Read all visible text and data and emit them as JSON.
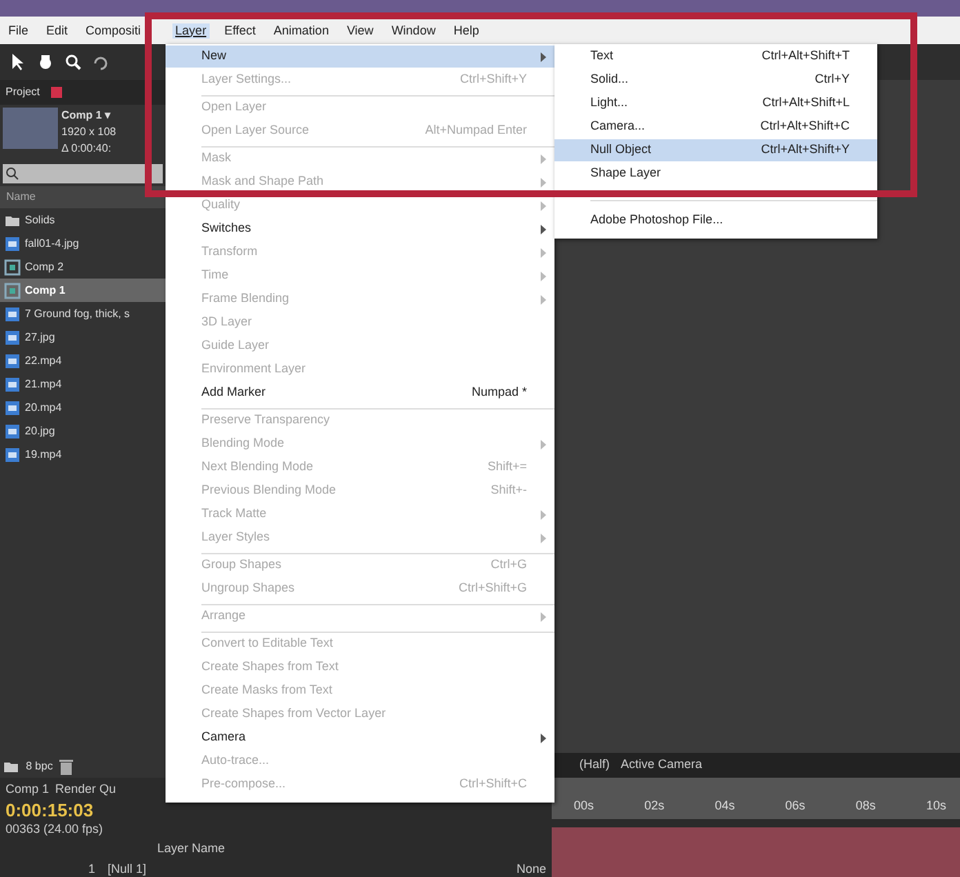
{
  "menubar": [
    {
      "label": "File",
      "selected": false
    },
    {
      "label": "Edit",
      "selected": false
    },
    {
      "label": "Compositi",
      "selected": false
    },
    {
      "label": "Layer",
      "selected": true
    },
    {
      "label": "Effect",
      "selected": false
    },
    {
      "label": "Animation",
      "selected": false
    },
    {
      "label": "View",
      "selected": false
    },
    {
      "label": "Window",
      "selected": false
    },
    {
      "label": "Help",
      "selected": false
    }
  ],
  "project_panel": {
    "tab": "Project",
    "comp_name": "Comp 1 ▾",
    "comp_size": "1920 x 108",
    "comp_duration": "Δ 0:00:40:",
    "column": "Name",
    "bit_depth": "8 bpc",
    "items": [
      {
        "kind": "folder",
        "name": "Solids",
        "selected": false
      },
      {
        "kind": "image",
        "name": "fall01-4.jpg",
        "selected": false
      },
      {
        "kind": "comp",
        "name": "Comp 2",
        "selected": false
      },
      {
        "kind": "comp",
        "name": "Comp 1",
        "selected": true
      },
      {
        "kind": "image",
        "name": "7 Ground fog, thick, s",
        "selected": false
      },
      {
        "kind": "image",
        "name": "27.jpg",
        "selected": false
      },
      {
        "kind": "image",
        "name": "22.mp4",
        "selected": false
      },
      {
        "kind": "image",
        "name": "21.mp4",
        "selected": false
      },
      {
        "kind": "image",
        "name": "20.mp4",
        "selected": false
      },
      {
        "kind": "image",
        "name": "20.jpg",
        "selected": false
      },
      {
        "kind": "image",
        "name": "19.mp4",
        "selected": false
      }
    ]
  },
  "layer_menu": [
    {
      "label": "New",
      "disabled": false,
      "submenu": true,
      "selected": true,
      "separator_before": false
    },
    {
      "label": "Layer Settings...",
      "shortcut": "Ctrl+Shift+Y",
      "disabled": true,
      "submenu": false,
      "selected": false,
      "separator_before": false
    },
    {
      "label": "Open Layer",
      "disabled": true,
      "submenu": false,
      "selected": false,
      "separator_before": true
    },
    {
      "label": "Open Layer Source",
      "shortcut": "Alt+Numpad Enter",
      "disabled": true,
      "submenu": false,
      "selected": false,
      "separator_before": false
    },
    {
      "label": "Mask",
      "disabled": true,
      "submenu": true,
      "selected": false,
      "separator_before": true
    },
    {
      "label": "Mask and Shape Path",
      "disabled": true,
      "submenu": true,
      "selected": false,
      "separator_before": false
    },
    {
      "label": "Quality",
      "disabled": true,
      "submenu": true,
      "selected": false,
      "separator_before": false
    },
    {
      "label": "Switches",
      "disabled": false,
      "submenu": true,
      "selected": false,
      "separator_before": false
    },
    {
      "label": "Transform",
      "disabled": true,
      "submenu": true,
      "selected": false,
      "separator_before": false
    },
    {
      "label": "Time",
      "disabled": true,
      "submenu": true,
      "selected": false,
      "separator_before": false
    },
    {
      "label": "Frame Blending",
      "disabled": true,
      "submenu": true,
      "selected": false,
      "separator_before": false
    },
    {
      "label": "3D Layer",
      "disabled": true,
      "submenu": false,
      "selected": false,
      "separator_before": false
    },
    {
      "label": "Guide Layer",
      "disabled": true,
      "submenu": false,
      "selected": false,
      "separator_before": false
    },
    {
      "label": "Environment Layer",
      "disabled": true,
      "submenu": false,
      "selected": false,
      "separator_before": false
    },
    {
      "label": "Add Marker",
      "shortcut": "Numpad *",
      "disabled": false,
      "submenu": false,
      "selected": false,
      "separator_before": false
    },
    {
      "label": "Preserve Transparency",
      "disabled": true,
      "submenu": false,
      "selected": false,
      "separator_before": true
    },
    {
      "label": "Blending Mode",
      "disabled": true,
      "submenu": true,
      "selected": false,
      "separator_before": false
    },
    {
      "label": "Next Blending Mode",
      "shortcut": "Shift+=",
      "disabled": true,
      "submenu": false,
      "selected": false,
      "separator_before": false
    },
    {
      "label": "Previous Blending Mode",
      "shortcut": "Shift+-",
      "disabled": true,
      "submenu": false,
      "selected": false,
      "separator_before": false
    },
    {
      "label": "Track Matte",
      "disabled": true,
      "submenu": true,
      "selected": false,
      "separator_before": false
    },
    {
      "label": "Layer Styles",
      "disabled": true,
      "submenu": true,
      "selected": false,
      "separator_before": false
    },
    {
      "label": "Group Shapes",
      "shortcut": "Ctrl+G",
      "disabled": true,
      "submenu": false,
      "selected": false,
      "separator_before": true
    },
    {
      "label": "Ungroup Shapes",
      "shortcut": "Ctrl+Shift+G",
      "disabled": true,
      "submenu": false,
      "selected": false,
      "separator_before": false
    },
    {
      "label": "Arrange",
      "disabled": true,
      "submenu": true,
      "selected": false,
      "separator_before": true
    },
    {
      "label": "Convert to Editable Text",
      "disabled": true,
      "submenu": false,
      "selected": false,
      "separator_before": true
    },
    {
      "label": "Create Shapes from Text",
      "disabled": true,
      "submenu": false,
      "selected": false,
      "separator_before": false
    },
    {
      "label": "Create Masks from Text",
      "disabled": true,
      "submenu": false,
      "selected": false,
      "separator_before": false
    },
    {
      "label": "Create Shapes from Vector Layer",
      "disabled": true,
      "submenu": false,
      "selected": false,
      "separator_before": false
    },
    {
      "label": "Camera",
      "disabled": false,
      "submenu": true,
      "selected": false,
      "separator_before": false
    },
    {
      "label": "Auto-trace...",
      "disabled": true,
      "submenu": false,
      "selected": false,
      "separator_before": false
    },
    {
      "label": "Pre-compose...",
      "shortcut": "Ctrl+Shift+C",
      "disabled": true,
      "submenu": false,
      "selected": false,
      "separator_before": false
    }
  ],
  "new_submenu": [
    {
      "label": "Text",
      "shortcut": "Ctrl+Alt+Shift+T",
      "selected": false,
      "separator_before": false
    },
    {
      "label": "Solid...",
      "shortcut": "Ctrl+Y",
      "selected": false,
      "separator_before": false
    },
    {
      "label": "Light...",
      "shortcut": "Ctrl+Alt+Shift+L",
      "selected": false,
      "separator_before": false
    },
    {
      "label": "Camera...",
      "shortcut": "Ctrl+Alt+Shift+C",
      "selected": false,
      "separator_before": false
    },
    {
      "label": "Null Object",
      "shortcut": "Ctrl+Alt+Shift+Y",
      "selected": true,
      "separator_before": false
    },
    {
      "label": "Shape Layer",
      "selected": false,
      "separator_before": false
    },
    {
      "label": "Adobe Photoshop File...",
      "selected": false,
      "separator_before": true
    }
  ],
  "viewer": {
    "resolution": "(Half)",
    "view": "Active Camera"
  },
  "timeline": {
    "tab": "Comp 1",
    "tab_2": "Render Qu",
    "timecode": "0:00:15:03",
    "frame_info": "00363 (24.00 fps)",
    "column_1": "Layer Name",
    "ruler": [
      "00s",
      "02s",
      "04s",
      "06s",
      "08s",
      "10s"
    ],
    "layers": [
      {
        "index": "1",
        "name": "[Null 1]",
        "parent": "None"
      }
    ]
  },
  "highlight": true
}
